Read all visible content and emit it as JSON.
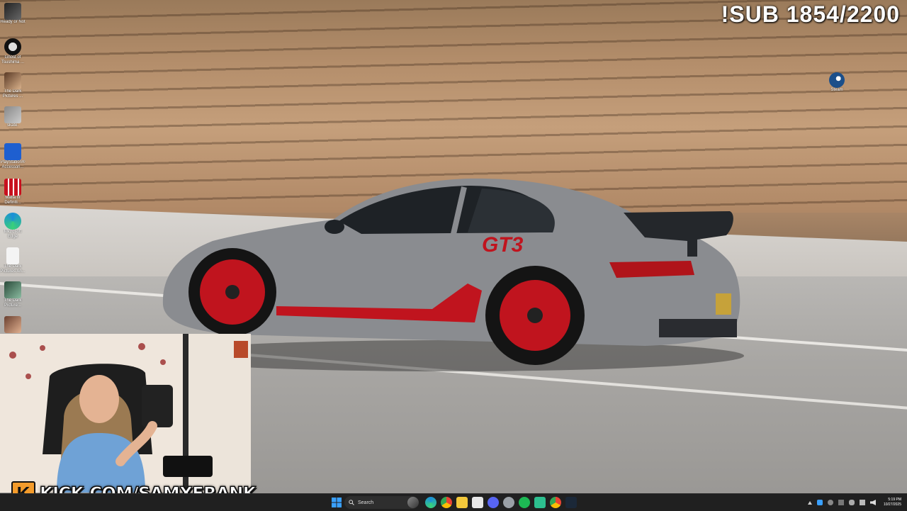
{
  "overlay": {
    "sub_counter": "!SUB 1854/2200",
    "kick_logo_letter": "K",
    "kick_url": "KICK.COM/SAMXFRANK"
  },
  "desktop_icons": [
    {
      "label": "Ready or Not"
    },
    {
      "label": "Ghost of Tsushima ..."
    },
    {
      "label": "The Dark Pictures ..."
    },
    {
      "label": "skate."
    },
    {
      "label": "PlayStation® Accessori..."
    },
    {
      "label": "Mafia III Definiti..."
    },
    {
      "label": "Microsoft Edge"
    },
    {
      "label": "The Dark Pictures An..."
    },
    {
      "label": "The Dark Picture..."
    }
  ],
  "desktop_right_icon": {
    "label": "Steam"
  },
  "car": {
    "decal": "GT3"
  },
  "taskbar": {
    "search_label": "Search",
    "clock_time": "5:19 PM",
    "clock_date": "10/27/2025"
  },
  "colors": {
    "taskbar_bg": "#202020",
    "kick_orange": "#f39b2b",
    "car_body": "#8a8c90",
    "wheel_red": "#c0141e"
  }
}
